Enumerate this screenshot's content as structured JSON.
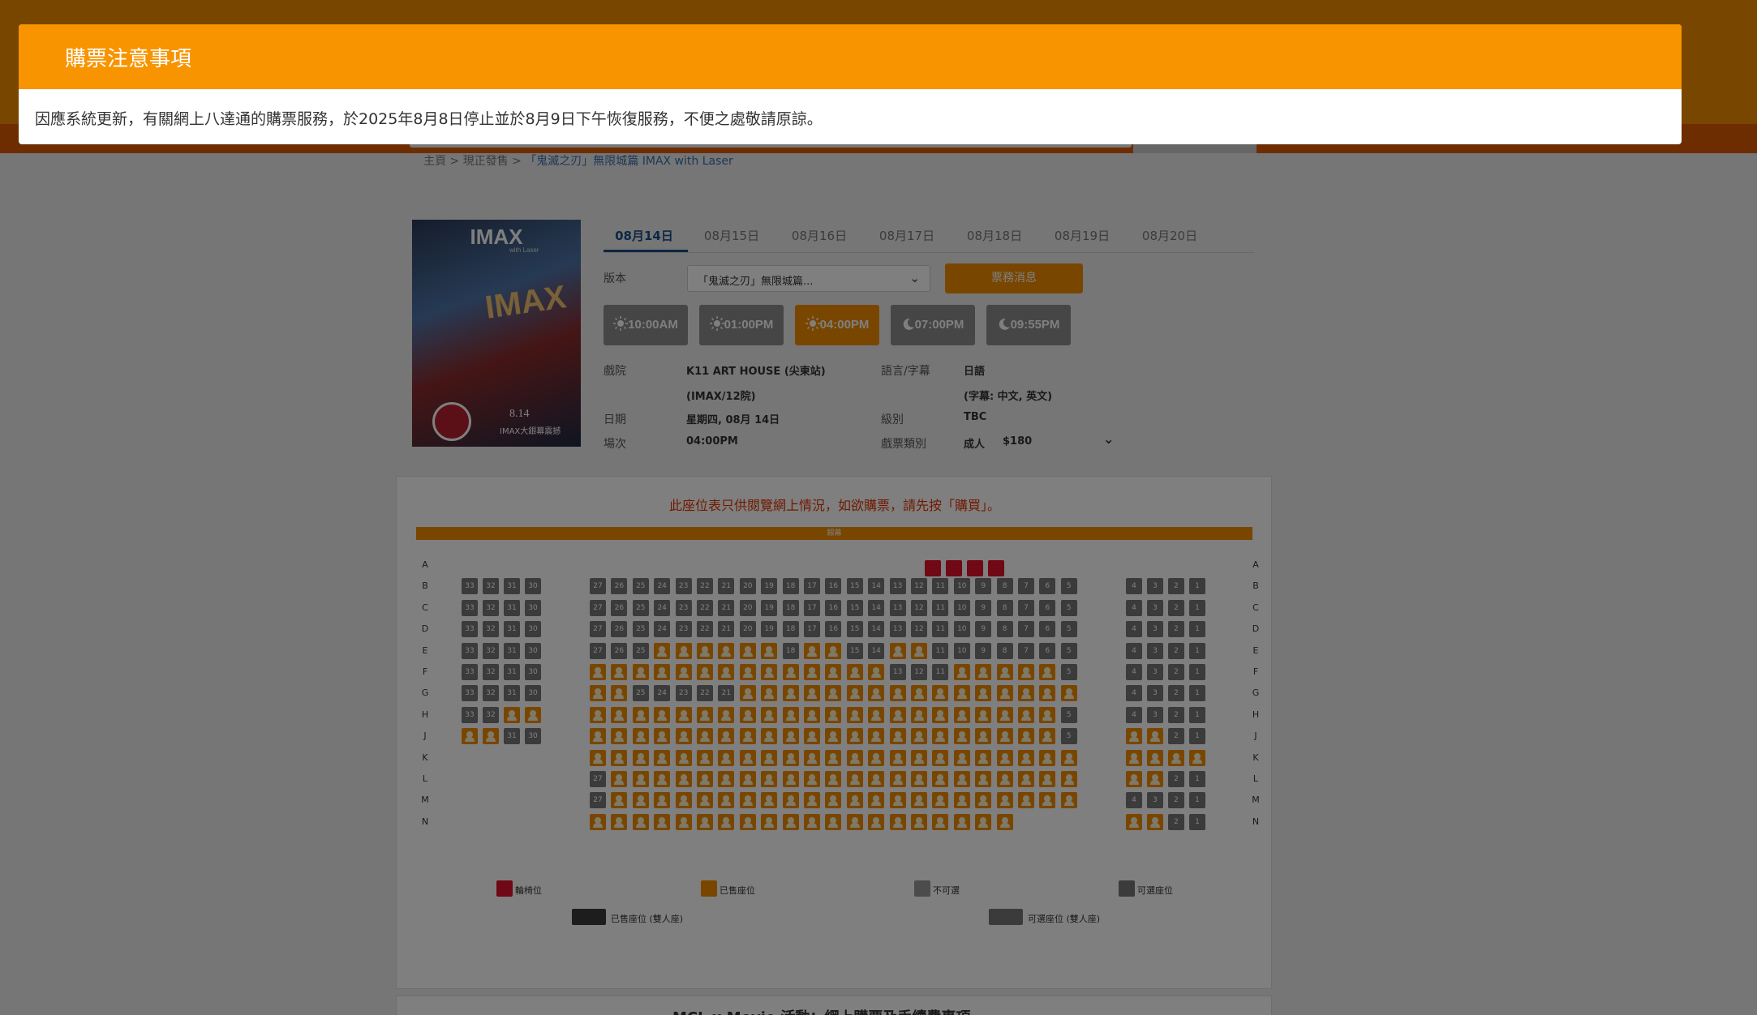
{
  "breadcrumb": {
    "home": "主頁 >",
    "section": "現正發售 >",
    "current": "「鬼滅之刃」無限城篇 IMAX with Laser"
  },
  "navlogo": "IMAX",
  "poster": {
    "brand": "IMAX",
    "brand_sub": "with Laser",
    "title_art": "IMAX",
    "release": "8.14",
    "release_sub": "IMAX大銀幕震撼"
  },
  "date_tabs": [
    "08月14日",
    "08月15日",
    "08月16日",
    "08月17日",
    "08月18日",
    "08月19日",
    "08月20日"
  ],
  "version": {
    "label": "版本",
    "selected": "「鬼滅之刃」無限城篇...",
    "chevron": "⌄",
    "notice_button": "票務消息"
  },
  "showtimes": [
    {
      "time": "10:00AM",
      "icon": "sun-icon"
    },
    {
      "time": "01:00PM",
      "icon": "sun-icon"
    },
    {
      "time": "04:00PM",
      "icon": "sun-icon"
    },
    {
      "time": "07:00PM",
      "icon": "moon-icon"
    },
    {
      "time": "09:55PM",
      "icon": "moon-icon"
    }
  ],
  "details": {
    "cinema_label": "戲院",
    "cinema_value": "K11 ART HOUSE (尖東站)",
    "cinema_house": "(IMAX/12院)",
    "date_label": "日期",
    "date_value": "星期四, 08月 14日",
    "session_label": "場次",
    "session_value": "04:00PM",
    "lang_label": "語言/字幕",
    "lang_value": "日語",
    "subtitle_value": "(字幕: 中文, 英文)",
    "rating_label": "級別",
    "rating_value": "TBC",
    "ticket_label": "戲票類別",
    "ticket_type": "成人",
    "ticket_price": "$180",
    "ticket_chevron": "⌄"
  },
  "seatmap": {
    "note": "此座位表只供閱覽網上情況，如欲購票，請先按「購買」。",
    "screen_label": "銀幕",
    "rows": [
      "A",
      "B",
      "C",
      "D",
      "E",
      "F",
      "G",
      "H",
      "J",
      "K",
      "L",
      "M",
      "N"
    ]
  },
  "legend": {
    "wheelchair": "輪椅位",
    "sold": "已售座位",
    "blocked": "不可選",
    "available": "可選座位",
    "sold_double": "已售座位 (雙人座)",
    "available_double": "可選座位 (雙人座)"
  },
  "bottom_panel_title": "MCL x Movie 活動：網上購票及手續費事項",
  "modal": {
    "title": "購票注意事項",
    "body": "因應系統更新，有關網上八達通的購票服務，於2025年8月8日停止並於8月9日下午恢復服務，不便之處敬請原諒。"
  },
  "colors": {
    "accent": "#f28d00",
    "modal_header": "#f89400",
    "active_tab": "#1d4f86",
    "wheelchair": "#e0102a",
    "seat_available": "#777777"
  }
}
